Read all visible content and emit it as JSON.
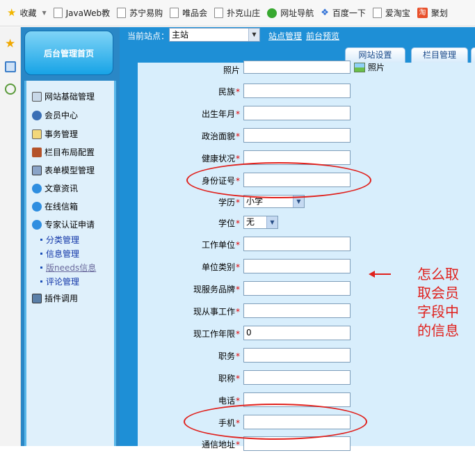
{
  "bookmarks": [
    {
      "label": "收藏",
      "icon": "star-icon"
    },
    {
      "label": "JavaWeb教",
      "icon": "page-icon"
    },
    {
      "label": "苏宁易购",
      "icon": "page-icon"
    },
    {
      "label": "唯品会",
      "icon": "page-icon"
    },
    {
      "label": "扑克山庄",
      "icon": "page-icon"
    },
    {
      "label": "网址导航",
      "icon": "green-globe-icon"
    },
    {
      "label": "百度一下",
      "icon": "baidu-paw-icon"
    },
    {
      "label": "爱淘宝",
      "icon": "page-icon"
    },
    {
      "label": "聚划",
      "icon": "taobao-icon"
    }
  ],
  "admin_nav": {
    "home_label": "后台管理首页",
    "items": [
      {
        "label": "网站基础管理",
        "icon": "settings-window-icon"
      },
      {
        "label": "会员中心",
        "icon": "members-icon"
      },
      {
        "label": "事务管理",
        "icon": "tasks-icon"
      },
      {
        "label": "栏目布局配置",
        "icon": "tools-icon"
      },
      {
        "label": "表单模型管理",
        "icon": "form-book-icon"
      },
      {
        "label": "文章资讯",
        "icon": "ie-icon"
      },
      {
        "label": "在线信箱",
        "icon": "ie-icon"
      },
      {
        "label": "专家认证申请",
        "icon": "ie-icon"
      }
    ],
    "sub_items": [
      "分类管理",
      "信息管理",
      "版needs信息",
      "评论管理"
    ],
    "last_item": {
      "label": "插件调用",
      "icon": "plugin-computer-icon"
    }
  },
  "top_bar": {
    "site_label": "当前站点：",
    "site_value": "主站",
    "links": [
      "站点管理",
      "前台预览"
    ],
    "tabs": [
      "网站设置",
      "栏目管理"
    ]
  },
  "form": {
    "photo_label": "照片",
    "photo_button": "照片",
    "fields": [
      {
        "label": "民族",
        "value": ""
      },
      {
        "label": "出生年月",
        "value": ""
      },
      {
        "label": "政治面貌",
        "value": ""
      },
      {
        "label": "健康状况",
        "value": ""
      },
      {
        "label": "身份证号",
        "value": ""
      }
    ],
    "selects": [
      {
        "label": "学历",
        "value": "小学"
      },
      {
        "label": "学位",
        "value": "无"
      }
    ],
    "fields2": [
      {
        "label": "工作单位",
        "value": ""
      },
      {
        "label": "单位类别",
        "value": ""
      },
      {
        "label": "现服务品牌",
        "value": ""
      },
      {
        "label": "现从事工作",
        "value": ""
      },
      {
        "label": "现工作年限",
        "value": "0"
      },
      {
        "label": "职务",
        "value": ""
      },
      {
        "label": "职称",
        "value": ""
      },
      {
        "label": "电话",
        "value": ""
      },
      {
        "label": "手机",
        "value": ""
      },
      {
        "label": "通信地址",
        "value": ""
      }
    ],
    "required_mark": "*"
  },
  "annotation": {
    "note": "怎么取取会员字段中的信息",
    "color": "#e0201c"
  }
}
